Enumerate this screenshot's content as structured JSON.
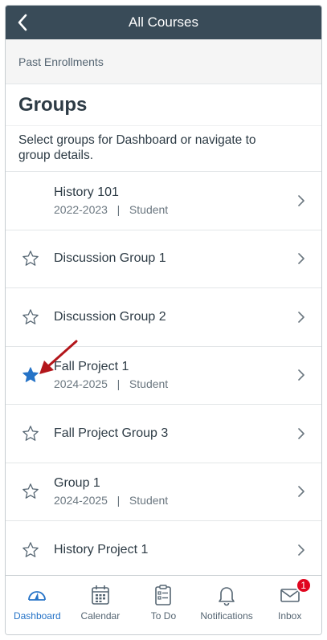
{
  "navbar": {
    "title": "All Courses"
  },
  "section_header": "Past Enrollments",
  "heading": "Groups",
  "description": "Select groups for Dashboard or navigate to group details.",
  "groups": [
    {
      "name": "History 101",
      "sub": "2022-2023   |   Student",
      "star": "none"
    },
    {
      "name": "Discussion Group 1",
      "sub": "",
      "star": "outline"
    },
    {
      "name": "Discussion Group 2",
      "sub": "",
      "star": "outline"
    },
    {
      "name": "Fall Project 1",
      "sub": "2024-2025   |   Student",
      "star": "filled"
    },
    {
      "name": "Fall Project Group 3",
      "sub": "",
      "star": "outline"
    },
    {
      "name": "Group 1",
      "sub": "2024-2025   |   Student",
      "star": "outline"
    },
    {
      "name": "History Project 1",
      "sub": "",
      "star": "outline"
    }
  ],
  "tabs": [
    {
      "label": "Dashboard",
      "icon": "dashboard-icon",
      "active": true
    },
    {
      "label": "Calendar",
      "icon": "calendar-icon"
    },
    {
      "label": "To Do",
      "icon": "todo-icon"
    },
    {
      "label": "Notifications",
      "icon": "bell-icon"
    },
    {
      "label": "Inbox",
      "icon": "mail-icon",
      "badge": "1"
    }
  ],
  "colors": {
    "navbar": "#394b58",
    "accent": "#2573c7",
    "star_filled": "#2573c7",
    "annotation_arrow": "#b3161b",
    "badge": "#e0061f"
  }
}
